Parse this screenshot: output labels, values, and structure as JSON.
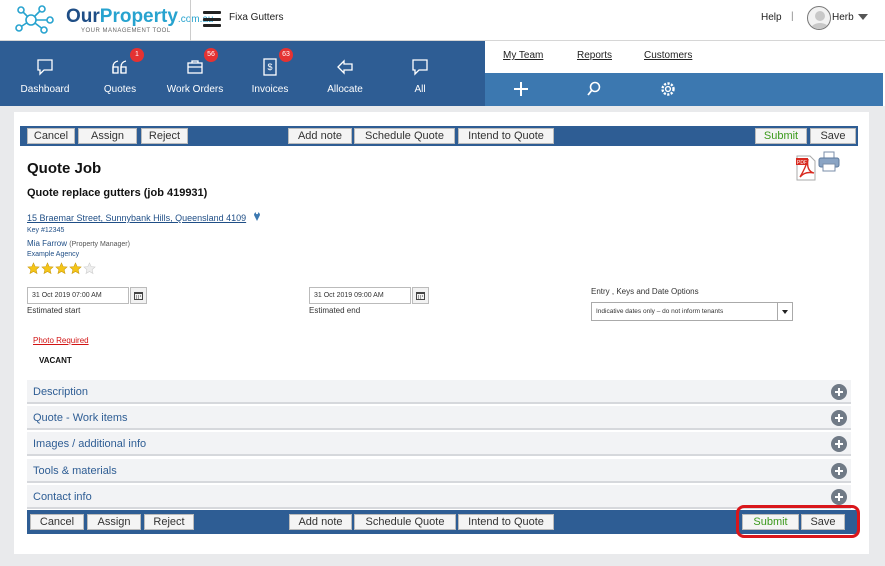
{
  "brand": {
    "logo_name_part1": "Our",
    "logo_name_part2": "Property",
    "logo_domain": ".com.au",
    "tagline": "YOUR MANAGEMENT TOOL",
    "company_name": "Fixa Gutters"
  },
  "header": {
    "help_label": "Help",
    "separator": "|",
    "user_name": "Herb"
  },
  "main_nav": [
    {
      "label": "Dashboard",
      "icon": "speech-bubble-icon",
      "badge": null
    },
    {
      "label": "Quotes",
      "icon": "quote-icon",
      "badge": "1"
    },
    {
      "label": "Work Orders",
      "icon": "briefcase-icon",
      "badge": "56"
    },
    {
      "label": "Invoices",
      "icon": "invoice-icon",
      "badge": "63"
    },
    {
      "label": "Allocate",
      "icon": "arrow-left-icon",
      "badge": null
    },
    {
      "label": "All",
      "icon": "speech-bubble-icon",
      "badge": null
    }
  ],
  "secondary_nav": {
    "links": [
      "My Team",
      "Reports",
      "Customers"
    ],
    "icons": [
      "plus-icon",
      "search-icon",
      "gear-icon"
    ]
  },
  "toolbar": {
    "cancel": "Cancel",
    "assign": "Assign",
    "reject": "Reject",
    "add_note": "Add note",
    "schedule_quote": "Schedule Quote",
    "intend_to_quote": "Intend to Quote",
    "submit": "Submit",
    "save": "Save"
  },
  "job": {
    "title": "Quote Job",
    "subtitle": "Quote replace gutters (job 419931)",
    "address": "15 Braemar Street, Sunnybank Hills, Queensland 4109",
    "key": "Key #12345",
    "manager_name": "Mia Farrow",
    "manager_role": "(Property Manager)",
    "agency": "Example Agency",
    "rating": 4,
    "rating_max": 5
  },
  "dates": {
    "start_value": "31 Oct 2019 07:00 AM",
    "start_label": "Estimated start",
    "end_value": "31 Oct 2019 09:00 AM",
    "end_label": "Estimated end",
    "entry_label": "Entry , Keys and Date Options",
    "entry_selected": "Indicative dates only – do not inform tenants"
  },
  "notes": {
    "photo_required": "Photo Required",
    "status": "VACANT"
  },
  "sections": [
    "Description",
    "Quote - Work items",
    "Images / additional info",
    "Tools & materials",
    "Contact info"
  ],
  "colors": {
    "nav_blue": "#2e5d94",
    "secondary_blue": "#3c78b0",
    "badge_red": "#e53232",
    "submit_green": "#3b9a1c",
    "highlight_red": "#d9161b",
    "link_red": "#d21313"
  }
}
